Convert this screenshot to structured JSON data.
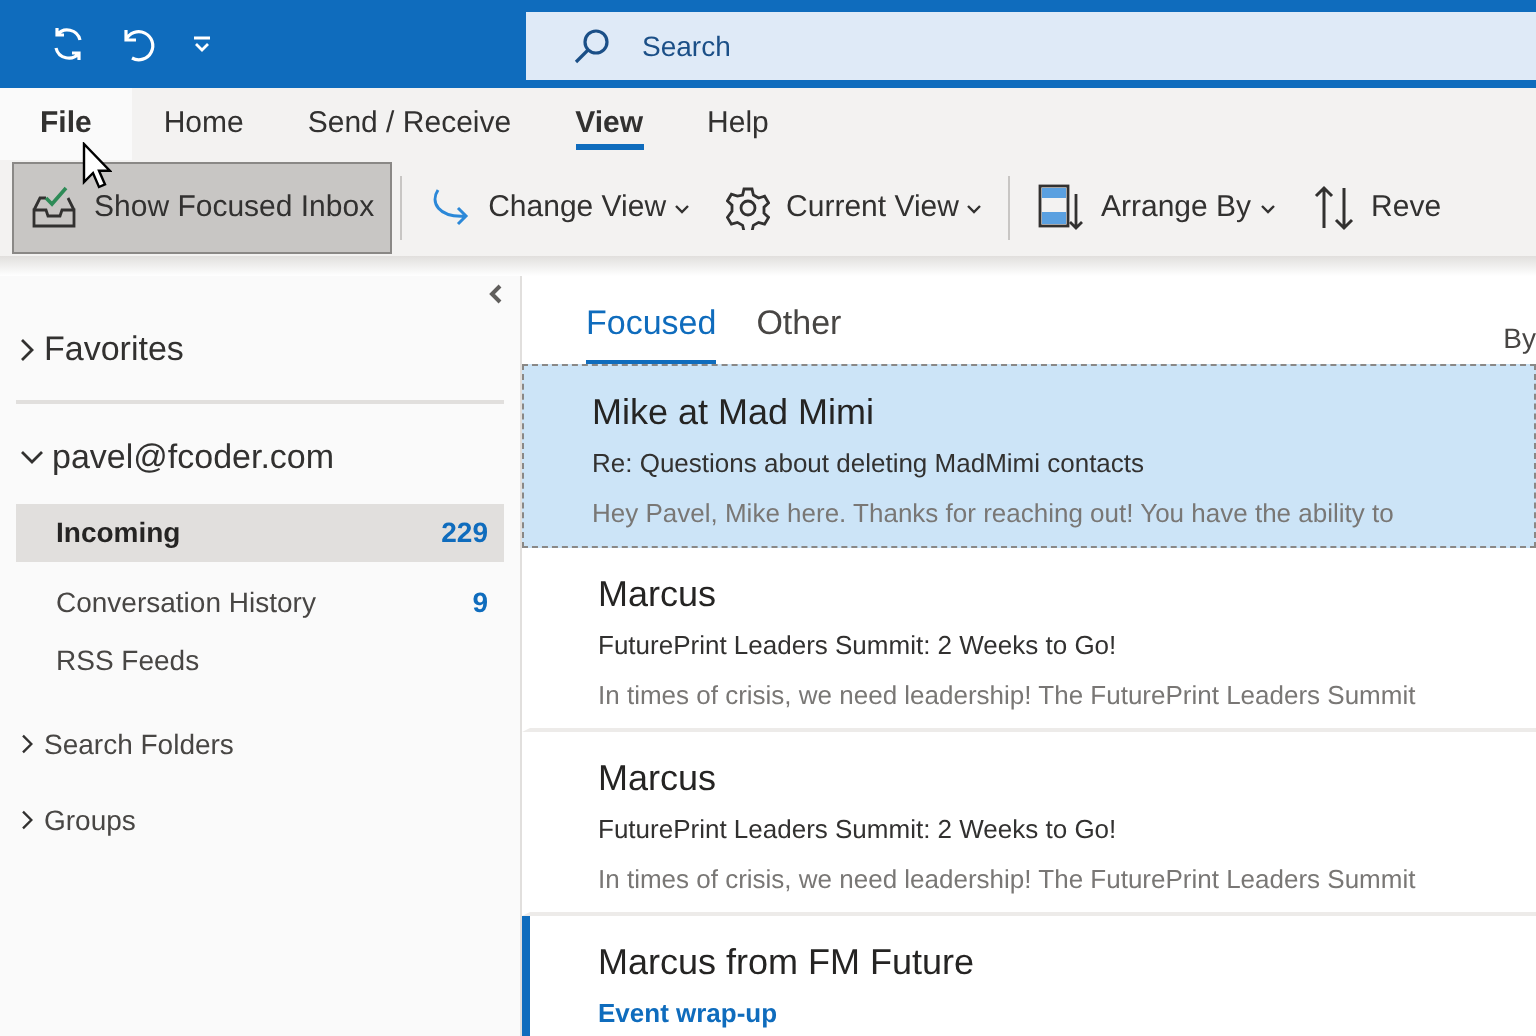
{
  "search": {
    "placeholder": "Search"
  },
  "ribbon_tabs": [
    {
      "label": "File",
      "kind": "file",
      "selected": false
    },
    {
      "label": "Home",
      "kind": "tab",
      "selected": false
    },
    {
      "label": "Send / Receive",
      "kind": "tab",
      "selected": false
    },
    {
      "label": "View",
      "kind": "tab",
      "selected": true
    },
    {
      "label": "Help",
      "kind": "tab",
      "selected": false
    }
  ],
  "toolbar": [
    {
      "label": "Show Focused Inbox",
      "kind": "toggle",
      "selected": true,
      "separator_before": false
    },
    {
      "label": "Change View",
      "kind": "dropdown",
      "separator_before": true
    },
    {
      "label": "Current View",
      "kind": "dropdown",
      "separator_before": false
    },
    {
      "label": "Arrange By",
      "kind": "dropdown",
      "separator_before": true
    },
    {
      "label": "Reve",
      "kind": "button",
      "separator_before": false
    }
  ],
  "sidebar": {
    "sections": [
      {
        "label": "Favorites",
        "kind": "major",
        "expanded": false
      },
      {
        "label": "pavel@fcoder.com",
        "kind": "major",
        "expanded": true,
        "children": [
          {
            "label": "Incoming",
            "count": "229",
            "selected": true
          },
          {
            "label": "Conversation History",
            "count": "9",
            "selected": false
          },
          {
            "label": "RSS Feeds",
            "selected": false
          }
        ]
      },
      {
        "label": "Search Folders",
        "kind": "minor",
        "expanded": false
      },
      {
        "label": "Groups",
        "kind": "minor",
        "expanded": false
      }
    ]
  },
  "mail_tabs": [
    {
      "label": "Focused",
      "selected": true
    },
    {
      "label": "Other",
      "selected": false
    }
  ],
  "sort_label": "By",
  "messages": [
    {
      "sender": "Mike at Mad Mimi",
      "subject": "Re: Questions about deleting MadMimi contacts",
      "preview": "Hey Pavel,  Mike here. Thanks for reaching out!  You have the ability to",
      "selected": true,
      "unread": false
    },
    {
      "sender": "Marcus",
      "subject": "FuturePrint Leaders Summit: 2 Weeks to Go!",
      "preview": "In times of crisis, we need leadership! The FuturePrint Leaders Summit",
      "selected": false,
      "unread": false
    },
    {
      "sender": "Marcus",
      "subject": "FuturePrint Leaders Summit: 2 Weeks to Go!",
      "preview": "In times of crisis, we need leadership! The FuturePrint Leaders Summit",
      "selected": false,
      "unread": false
    },
    {
      "sender": "Marcus from FM Future",
      "subject": "Event wrap-up",
      "selected": false,
      "unread": true
    }
  ]
}
